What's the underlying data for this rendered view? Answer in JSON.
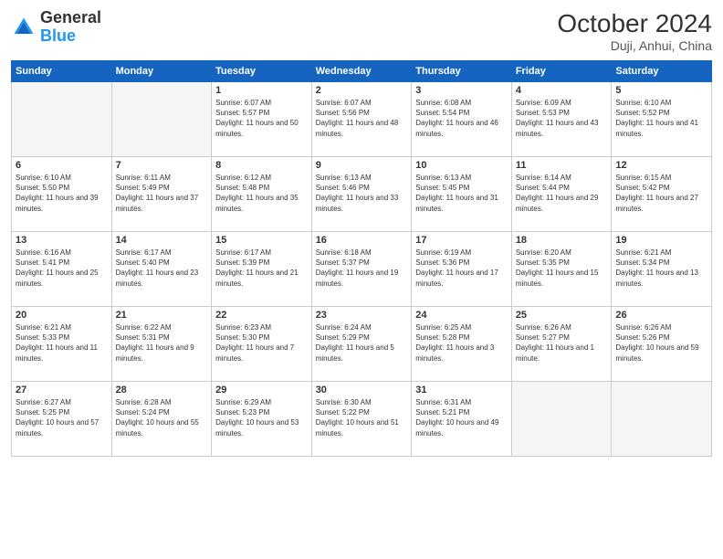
{
  "header": {
    "logo_general": "General",
    "logo_blue": "Blue",
    "month_title": "October 2024",
    "location": "Duji, Anhui, China"
  },
  "days_of_week": [
    "Sunday",
    "Monday",
    "Tuesday",
    "Wednesday",
    "Thursday",
    "Friday",
    "Saturday"
  ],
  "weeks": [
    [
      {
        "day": "",
        "sunrise": "",
        "sunset": "",
        "daylight": "",
        "empty": true
      },
      {
        "day": "",
        "sunrise": "",
        "sunset": "",
        "daylight": "",
        "empty": true
      },
      {
        "day": "1",
        "sunrise": "Sunrise: 6:07 AM",
        "sunset": "Sunset: 5:57 PM",
        "daylight": "Daylight: 11 hours and 50 minutes."
      },
      {
        "day": "2",
        "sunrise": "Sunrise: 6:07 AM",
        "sunset": "Sunset: 5:56 PM",
        "daylight": "Daylight: 11 hours and 48 minutes."
      },
      {
        "day": "3",
        "sunrise": "Sunrise: 6:08 AM",
        "sunset": "Sunset: 5:54 PM",
        "daylight": "Daylight: 11 hours and 46 minutes."
      },
      {
        "day": "4",
        "sunrise": "Sunrise: 6:09 AM",
        "sunset": "Sunset: 5:53 PM",
        "daylight": "Daylight: 11 hours and 43 minutes."
      },
      {
        "day": "5",
        "sunrise": "Sunrise: 6:10 AM",
        "sunset": "Sunset: 5:52 PM",
        "daylight": "Daylight: 11 hours and 41 minutes."
      }
    ],
    [
      {
        "day": "6",
        "sunrise": "Sunrise: 6:10 AM",
        "sunset": "Sunset: 5:50 PM",
        "daylight": "Daylight: 11 hours and 39 minutes."
      },
      {
        "day": "7",
        "sunrise": "Sunrise: 6:11 AM",
        "sunset": "Sunset: 5:49 PM",
        "daylight": "Daylight: 11 hours and 37 minutes."
      },
      {
        "day": "8",
        "sunrise": "Sunrise: 6:12 AM",
        "sunset": "Sunset: 5:48 PM",
        "daylight": "Daylight: 11 hours and 35 minutes."
      },
      {
        "day": "9",
        "sunrise": "Sunrise: 6:13 AM",
        "sunset": "Sunset: 5:46 PM",
        "daylight": "Daylight: 11 hours and 33 minutes."
      },
      {
        "day": "10",
        "sunrise": "Sunrise: 6:13 AM",
        "sunset": "Sunset: 5:45 PM",
        "daylight": "Daylight: 11 hours and 31 minutes."
      },
      {
        "day": "11",
        "sunrise": "Sunrise: 6:14 AM",
        "sunset": "Sunset: 5:44 PM",
        "daylight": "Daylight: 11 hours and 29 minutes."
      },
      {
        "day": "12",
        "sunrise": "Sunrise: 6:15 AM",
        "sunset": "Sunset: 5:42 PM",
        "daylight": "Daylight: 11 hours and 27 minutes."
      }
    ],
    [
      {
        "day": "13",
        "sunrise": "Sunrise: 6:16 AM",
        "sunset": "Sunset: 5:41 PM",
        "daylight": "Daylight: 11 hours and 25 minutes."
      },
      {
        "day": "14",
        "sunrise": "Sunrise: 6:17 AM",
        "sunset": "Sunset: 5:40 PM",
        "daylight": "Daylight: 11 hours and 23 minutes."
      },
      {
        "day": "15",
        "sunrise": "Sunrise: 6:17 AM",
        "sunset": "Sunset: 5:39 PM",
        "daylight": "Daylight: 11 hours and 21 minutes."
      },
      {
        "day": "16",
        "sunrise": "Sunrise: 6:18 AM",
        "sunset": "Sunset: 5:37 PM",
        "daylight": "Daylight: 11 hours and 19 minutes."
      },
      {
        "day": "17",
        "sunrise": "Sunrise: 6:19 AM",
        "sunset": "Sunset: 5:36 PM",
        "daylight": "Daylight: 11 hours and 17 minutes."
      },
      {
        "day": "18",
        "sunrise": "Sunrise: 6:20 AM",
        "sunset": "Sunset: 5:35 PM",
        "daylight": "Daylight: 11 hours and 15 minutes."
      },
      {
        "day": "19",
        "sunrise": "Sunrise: 6:21 AM",
        "sunset": "Sunset: 5:34 PM",
        "daylight": "Daylight: 11 hours and 13 minutes."
      }
    ],
    [
      {
        "day": "20",
        "sunrise": "Sunrise: 6:21 AM",
        "sunset": "Sunset: 5:33 PM",
        "daylight": "Daylight: 11 hours and 11 minutes."
      },
      {
        "day": "21",
        "sunrise": "Sunrise: 6:22 AM",
        "sunset": "Sunset: 5:31 PM",
        "daylight": "Daylight: 11 hours and 9 minutes."
      },
      {
        "day": "22",
        "sunrise": "Sunrise: 6:23 AM",
        "sunset": "Sunset: 5:30 PM",
        "daylight": "Daylight: 11 hours and 7 minutes."
      },
      {
        "day": "23",
        "sunrise": "Sunrise: 6:24 AM",
        "sunset": "Sunset: 5:29 PM",
        "daylight": "Daylight: 11 hours and 5 minutes."
      },
      {
        "day": "24",
        "sunrise": "Sunrise: 6:25 AM",
        "sunset": "Sunset: 5:28 PM",
        "daylight": "Daylight: 11 hours and 3 minutes."
      },
      {
        "day": "25",
        "sunrise": "Sunrise: 6:26 AM",
        "sunset": "Sunset: 5:27 PM",
        "daylight": "Daylight: 11 hours and 1 minute."
      },
      {
        "day": "26",
        "sunrise": "Sunrise: 6:26 AM",
        "sunset": "Sunset: 5:26 PM",
        "daylight": "Daylight: 10 hours and 59 minutes."
      }
    ],
    [
      {
        "day": "27",
        "sunrise": "Sunrise: 6:27 AM",
        "sunset": "Sunset: 5:25 PM",
        "daylight": "Daylight: 10 hours and 57 minutes."
      },
      {
        "day": "28",
        "sunrise": "Sunrise: 6:28 AM",
        "sunset": "Sunset: 5:24 PM",
        "daylight": "Daylight: 10 hours and 55 minutes."
      },
      {
        "day": "29",
        "sunrise": "Sunrise: 6:29 AM",
        "sunset": "Sunset: 5:23 PM",
        "daylight": "Daylight: 10 hours and 53 minutes."
      },
      {
        "day": "30",
        "sunrise": "Sunrise: 6:30 AM",
        "sunset": "Sunset: 5:22 PM",
        "daylight": "Daylight: 10 hours and 51 minutes."
      },
      {
        "day": "31",
        "sunrise": "Sunrise: 6:31 AM",
        "sunset": "Sunset: 5:21 PM",
        "daylight": "Daylight: 10 hours and 49 minutes."
      },
      {
        "day": "",
        "sunrise": "",
        "sunset": "",
        "daylight": "",
        "empty": true
      },
      {
        "day": "",
        "sunrise": "",
        "sunset": "",
        "daylight": "",
        "empty": true
      }
    ]
  ]
}
